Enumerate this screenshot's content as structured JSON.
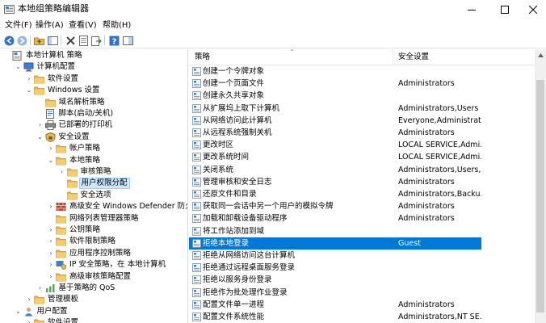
{
  "window": {
    "title": "本地组策略编辑器",
    "minimize": "—",
    "maximize": "☐",
    "close": "✕"
  },
  "menu": [
    "文件(F)",
    "操作(A)",
    "查看(V)",
    "帮助(H)"
  ],
  "toolbar_icons": [
    "back-icon",
    "forward-icon",
    "up-folder-icon",
    "show-hide-tree-icon",
    "delete-icon",
    "properties-icon",
    "export-icon",
    "help-icon",
    "view-icon"
  ],
  "tree": [
    {
      "label": "本地计算机 策略",
      "level": 0,
      "arrow": "",
      "icon": "computer-policy-icon"
    },
    {
      "label": "计算机配置",
      "level": 1,
      "arrow": "open",
      "icon": "computer-icon"
    },
    {
      "label": "软件设置",
      "level": 2,
      "arrow": "closed",
      "icon": "folder-icon"
    },
    {
      "label": "Windows 设置",
      "level": 2,
      "arrow": "open",
      "icon": "folder-icon"
    },
    {
      "label": "域名解析策略",
      "level": 3,
      "arrow": "",
      "icon": "folder-icon"
    },
    {
      "label": "脚本(启动/关机)",
      "level": 3,
      "arrow": "",
      "icon": "script-icon"
    },
    {
      "label": "已部署的打印机",
      "level": 3,
      "arrow": "closed",
      "icon": "printer-icon"
    },
    {
      "label": "安全设置",
      "level": 3,
      "arrow": "open",
      "icon": "security-icon"
    },
    {
      "label": "帐户策略",
      "level": 4,
      "arrow": "closed",
      "icon": "folder-icon"
    },
    {
      "label": "本地策略",
      "level": 4,
      "arrow": "open",
      "icon": "folder-icon"
    },
    {
      "label": "审核策略",
      "level": 5,
      "arrow": "closed",
      "icon": "folder-icon"
    },
    {
      "label": "用户权限分配",
      "level": 5,
      "arrow": "",
      "icon": "folder-icon",
      "selected": true
    },
    {
      "label": "安全选项",
      "level": 5,
      "arrow": "",
      "icon": "folder-icon"
    },
    {
      "label": "高级安全 Windows Defender 防火墙",
      "level": 4,
      "arrow": "closed",
      "icon": "firewall-icon"
    },
    {
      "label": "网络列表管理器策略",
      "level": 4,
      "arrow": "",
      "icon": "folder-icon"
    },
    {
      "label": "公钥策略",
      "level": 4,
      "arrow": "closed",
      "icon": "folder-icon"
    },
    {
      "label": "软件限制策略",
      "level": 4,
      "arrow": "closed",
      "icon": "folder-icon"
    },
    {
      "label": "应用程序控制策略",
      "level": 4,
      "arrow": "closed",
      "icon": "folder-icon"
    },
    {
      "label": "IP 安全策略，在 本地计算机",
      "level": 4,
      "arrow": "closed",
      "icon": "ip-security-icon"
    },
    {
      "label": "高级审核策略配置",
      "level": 4,
      "arrow": "closed",
      "icon": "folder-icon"
    },
    {
      "label": "基于策略的 QoS",
      "level": 3,
      "arrow": "closed",
      "icon": "qos-icon"
    },
    {
      "label": "管理模板",
      "level": 2,
      "arrow": "closed",
      "icon": "folder-icon"
    },
    {
      "label": "用户配置",
      "level": 1,
      "arrow": "open",
      "icon": "user-icon"
    },
    {
      "label": "软件设置",
      "level": 2,
      "arrow": "closed",
      "icon": "folder-icon"
    }
  ],
  "columns": {
    "policy": "策略",
    "setting": "安全设置"
  },
  "rows": [
    {
      "policy": "创建一个令牌对象",
      "setting": ""
    },
    {
      "policy": "创建一个页面文件",
      "setting": "Administrators"
    },
    {
      "policy": "创建永久共享对象",
      "setting": ""
    },
    {
      "policy": "从扩展坞上取下计算机",
      "setting": "Administrators,Users"
    },
    {
      "policy": "从网络访问此计算机",
      "setting": "Everyone,Administrat..."
    },
    {
      "policy": "从远程系统强制关机",
      "setting": "Administrators"
    },
    {
      "policy": "更改时区",
      "setting": "LOCAL SERVICE,Admi..."
    },
    {
      "policy": "更改系统时间",
      "setting": "LOCAL SERVICE,Admi..."
    },
    {
      "policy": "关闭系统",
      "setting": "Administrators,Users,..."
    },
    {
      "policy": "管理审核和安全日志",
      "setting": "Administrators"
    },
    {
      "policy": "还原文件和目录",
      "setting": "Administrators,Backu..."
    },
    {
      "policy": "获取同一会话中另一个用户的模拟令牌",
      "setting": "Administrators"
    },
    {
      "policy": "加载和卸载设备驱动程序",
      "setting": "Administrators"
    },
    {
      "policy": "将工作站添加到域",
      "setting": ""
    },
    {
      "policy": "拒绝本地登录",
      "setting": "Guest",
      "selected": true
    },
    {
      "policy": "拒绝从网络访问这台计算机",
      "setting": ""
    },
    {
      "policy": "拒绝通过远程桌面服务登录",
      "setting": ""
    },
    {
      "policy": "拒绝以服务身份登录",
      "setting": ""
    },
    {
      "policy": "拒绝作为批处理作业登录",
      "setting": ""
    },
    {
      "policy": "配置文件单一进程",
      "setting": "Administrators"
    },
    {
      "policy": "配置文件系统性能",
      "setting": "Administrators,NT SE..."
    }
  ],
  "colors": {
    "selection": "#0078d7",
    "tree_selection": "#cce8ff",
    "folder": "#e8b64a"
  }
}
